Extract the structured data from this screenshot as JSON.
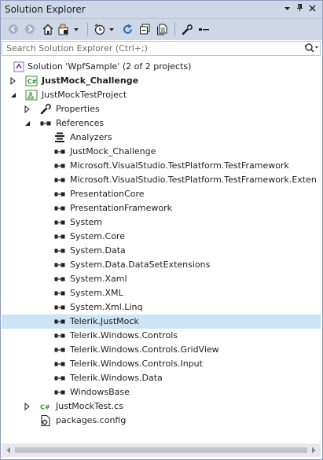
{
  "window": {
    "title": "Solution Explorer"
  },
  "search": {
    "placeholder": "Search Solution Explorer (Ctrl+;)"
  },
  "tree": {
    "solution": "Solution 'WpfSample' (2 of 2 projects)",
    "project_challenge": "JustMock_Challenge",
    "project_test": "JustMockTestProject",
    "properties": "Properties",
    "references": "References",
    "refs": [
      "Analyzers",
      "JustMock_Challenge",
      "Microsoft.VisualStudio.TestPlatform.TestFramework",
      "Microsoft.VisualStudio.TestPlatform.TestFramework.Exten",
      "PresentationCore",
      "PresentationFramework",
      "System",
      "System.Core",
      "System.Data",
      "System.Data.DataSetExtensions",
      "System.Xaml",
      "System.XML",
      "System.Xml.Linq",
      "Telerik.JustMock",
      "Telerik.Windows.Controls",
      "Telerik.Windows.Controls.GridView",
      "Telerik.Windows.Controls.Input",
      "Telerik.Windows.Data",
      "WindowsBase"
    ],
    "file_cs": "JustMockTest.cs",
    "file_config": "packages.config"
  }
}
